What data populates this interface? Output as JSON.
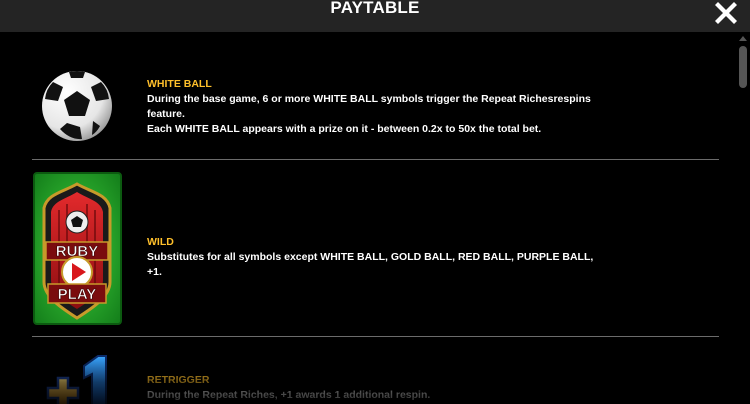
{
  "header": {
    "title": "PAYTABLE",
    "close_icon": "close-icon"
  },
  "entries": [
    {
      "title": "WHITE BALL",
      "description": "During the base game, 6 or more WHITE BALL symbols trigger the Repeat Richesrespins\nfeature.\nEach WHITE BALL appears with a prize on it - between 0.2x to 50x the total bet.",
      "symbol_icon": "soccer-ball-icon"
    },
    {
      "title": "WILD",
      "description": "Substitutes for all symbols except WHITE BALL, GOLD BALL, RED BALL, PURPLE BALL, +1.",
      "symbol_icon": "ruby-play-wild-icon",
      "symbol_text_top": "RUBY",
      "symbol_text_bottom": "PLAY"
    },
    {
      "title": "RETRIGGER",
      "description": "During the Repeat Riches, +1 awards 1 additional respin.",
      "symbol_icon": "plus-one-icon"
    }
  ],
  "colors": {
    "header_bg": "#242424",
    "title_accent": "#ffc02b",
    "divider": "#6b6b6b",
    "symbol_green": "#27b52b",
    "symbol_red": "#c8151b"
  }
}
